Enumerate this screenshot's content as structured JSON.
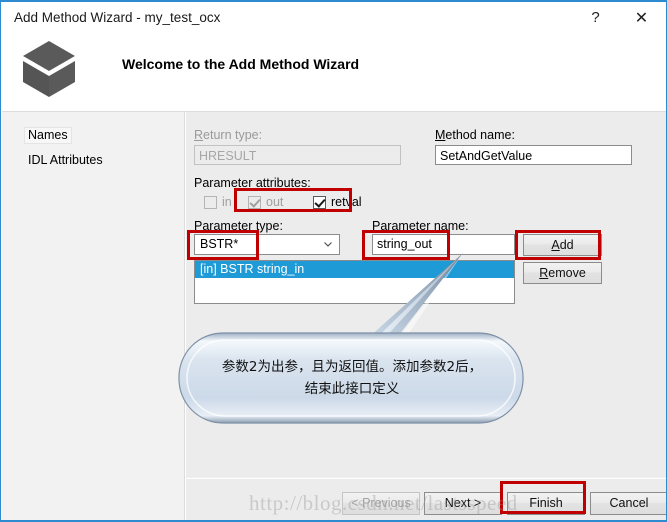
{
  "window": {
    "title": "Add Method Wizard - my_test_ocx",
    "help_label": "?",
    "close_label": "✕",
    "icon": "cube-icon"
  },
  "header": {
    "title": "Welcome to the Add Method Wizard"
  },
  "sidebar": {
    "items": [
      {
        "label": "Names",
        "selected": true
      },
      {
        "label": "IDL Attributes",
        "selected": false
      }
    ]
  },
  "form": {
    "return_type_label": "Return type:",
    "return_type_value": "HRESULT",
    "return_type_enabled": false,
    "method_name_label": "Method name:",
    "method_name_value": "SetAndGetValue",
    "parameter_attributes_label": "Parameter attributes:",
    "attributes": [
      {
        "label": "in",
        "checked": false,
        "enabled": false
      },
      {
        "label": "out",
        "checked": true,
        "enabled": false
      },
      {
        "label": "retval",
        "checked": true,
        "enabled": true
      }
    ],
    "parameter_type_label": "Parameter type:",
    "parameter_type_value": "BSTR*",
    "parameter_name_label": "Parameter name:",
    "parameter_name_value": "string_out",
    "add_button": "Add",
    "remove_button": "Remove",
    "parameter_list": [
      {
        "text": "[in] BSTR string_in",
        "selected": true
      }
    ]
  },
  "footer": {
    "previous": "< Previous",
    "next": "Next >",
    "finish": "Finish",
    "cancel": "Cancel"
  },
  "callout": {
    "text": "参数2为出参，且为返回值。添加参数2后，结束此接口定义"
  },
  "watermark": {
    "text": "http://blog.csdn.net/lastsspeed"
  },
  "colors": {
    "window_border": "#2e8bd0",
    "selection": "#1e9ad6",
    "annotation": "#c00000",
    "panel": "#ececec"
  }
}
